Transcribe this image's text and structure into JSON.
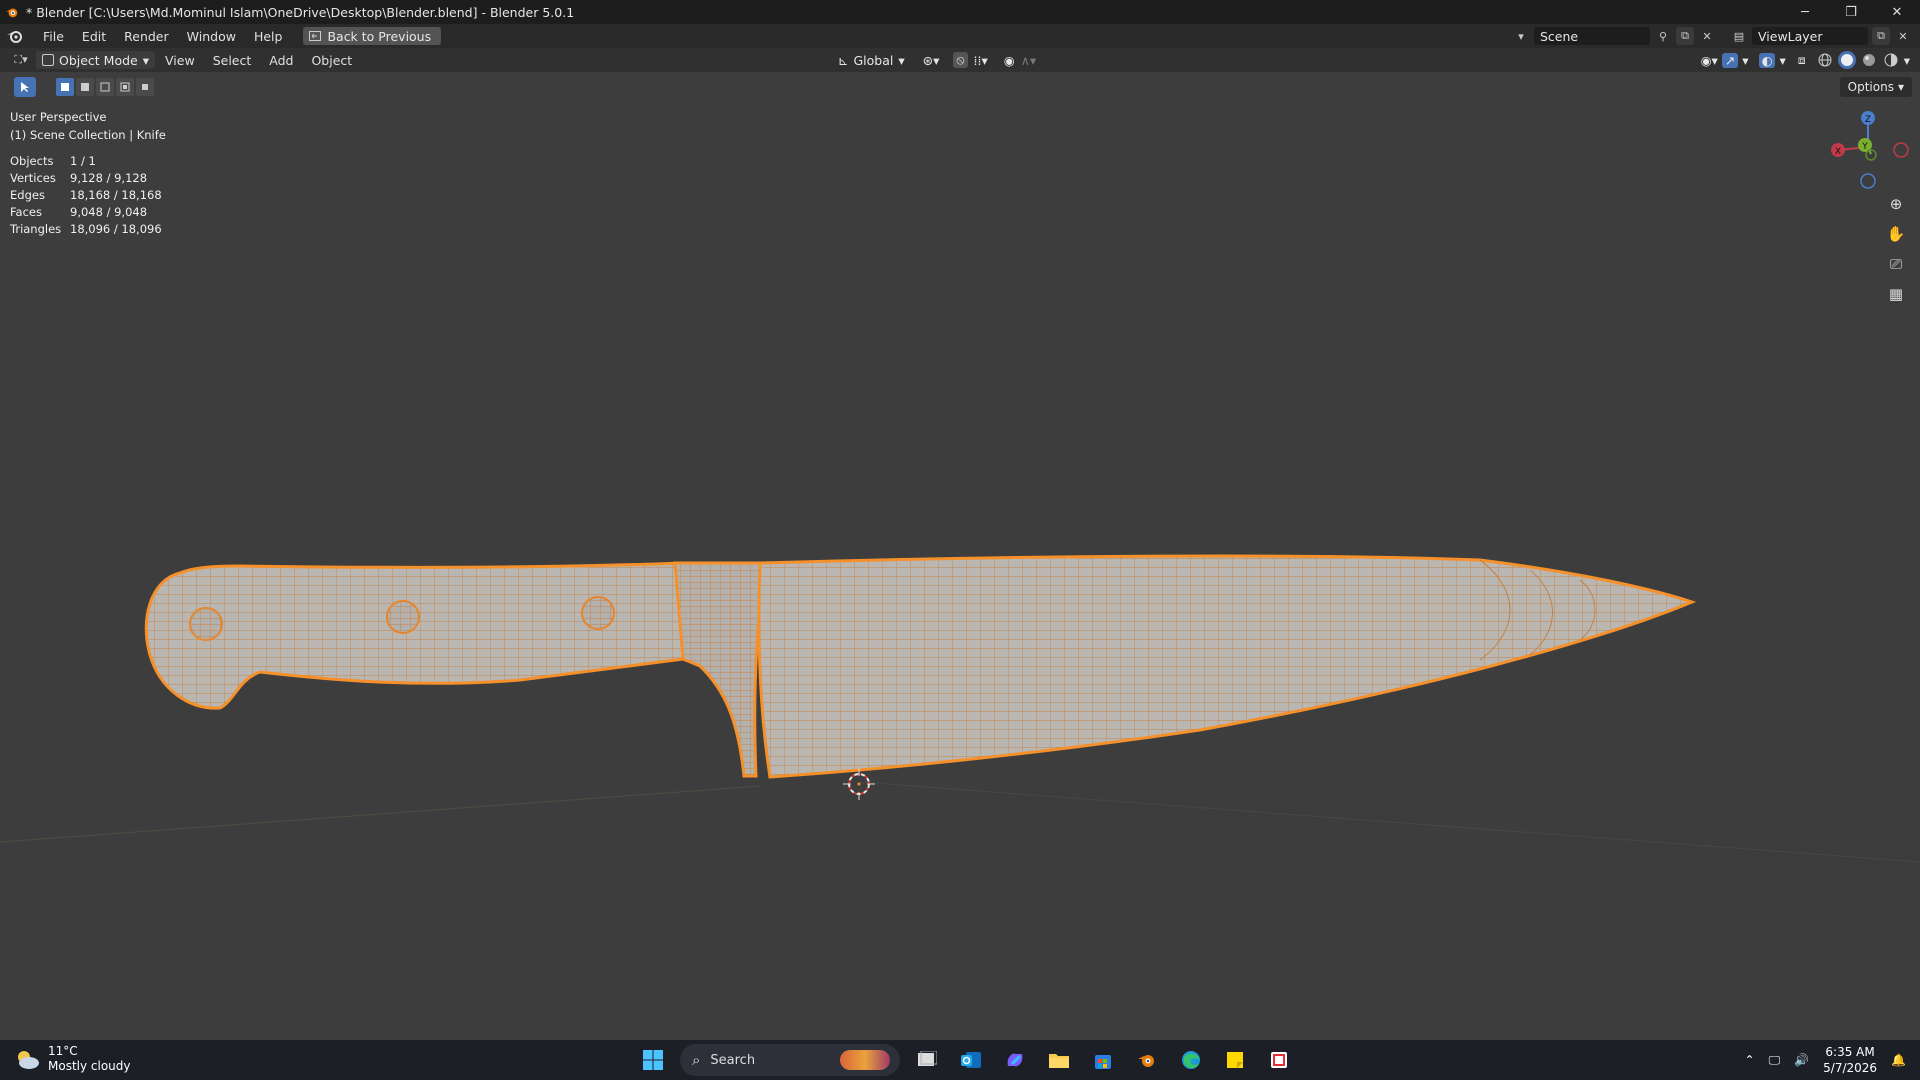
{
  "titlebar": {
    "title": "* Blender [C:\\Users\\Md.Mominul Islam\\OneDrive\\Desktop\\Blender.blend] - Blender 5.0.1",
    "minimize": "─",
    "maximize": "❐",
    "close": "✕"
  },
  "topbar": {
    "menus": [
      "File",
      "Edit",
      "Render",
      "Window",
      "Help"
    ],
    "back_button": "Back to Previous",
    "scene": "Scene",
    "view_layer": "ViewLayer"
  },
  "viewport_header": {
    "mode": "Object Mode",
    "menus": [
      "View",
      "Select",
      "Add",
      "Object"
    ],
    "transform_orientation": "Global"
  },
  "toolbar": {
    "options_label": "Options"
  },
  "overlay": {
    "perspective": "User Perspective",
    "collection": "(1) Scene Collection | Knife",
    "stats": [
      {
        "label": "Objects",
        "value": "1 / 1"
      },
      {
        "label": "Vertices",
        "value": "9,128 / 9,128"
      },
      {
        "label": "Edges",
        "value": "18,168 / 18,168"
      },
      {
        "label": "Faces",
        "value": "9,048 / 9,048"
      },
      {
        "label": "Triangles",
        "value": "18,096 / 18,096"
      }
    ]
  },
  "gizmo": {
    "z": "Z",
    "y": "Y",
    "x": "X"
  },
  "taskbar": {
    "temperature": "11°C",
    "weather": "Mostly cloudy",
    "search": "Search",
    "time": "6:35 AM",
    "date": "5/7/2026"
  },
  "colors": {
    "accent": "#4772b3",
    "selection_outline": "#f5902a",
    "mesh_surface": "#b8b4b0",
    "viewport_bg": "#3d3d3d"
  }
}
